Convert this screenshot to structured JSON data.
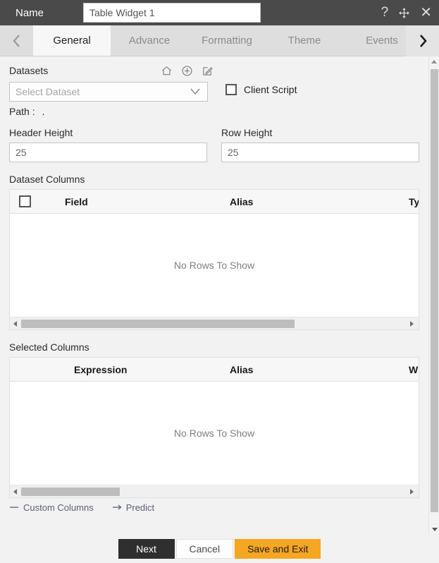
{
  "titlebar": {
    "name_label": "Name",
    "name_value": "Table Widget 1",
    "name_placeholder": "Name",
    "help_icon": "question-mark-icon",
    "move_icon": "move-arrows-icon",
    "close_icon": "close-icon"
  },
  "tabs": {
    "prev_icon": "chevron-left-icon",
    "next_icon": "chevron-right-icon",
    "items": [
      {
        "label": "General",
        "active": true
      },
      {
        "label": "Advance",
        "active": false
      },
      {
        "label": "Formatting",
        "active": false
      },
      {
        "label": "Theme",
        "active": false
      },
      {
        "label": "Events",
        "active": false
      }
    ]
  },
  "general": {
    "datasets_label": "Datasets",
    "dataset_icons": [
      {
        "name": "home-icon"
      },
      {
        "name": "add-circle-icon"
      },
      {
        "name": "edit-pencil-icon"
      }
    ],
    "dataset_select_placeholder": "Select Dataset",
    "dataset_select_value": "",
    "dropdown_icon": "chevron-down-icon",
    "client_script_label": "Client Script",
    "client_script_checked": false,
    "path_label": "Path :",
    "path_value": ".",
    "header_height_label": "Header Height",
    "header_height_value": "25",
    "row_height_label": "Row Height",
    "row_height_value": "25"
  },
  "dataset_columns": {
    "title": "Dataset Columns",
    "select_all_checked": false,
    "columns": [
      "Field",
      "Alias",
      "Ty"
    ],
    "rows": [],
    "empty_message": "No Rows To Show",
    "scroll_left_icon": "triangle-left-icon",
    "scroll_right_icon": "triangle-right-icon"
  },
  "selected_columns": {
    "title": "Selected Columns",
    "columns": [
      "Expression",
      "Alias",
      "W"
    ],
    "rows": [],
    "empty_message": "No Rows To Show",
    "scroll_left_icon": "triangle-left-icon",
    "scroll_right_icon": "triangle-right-icon"
  },
  "bottom_links": [
    {
      "label": "Custom Columns",
      "icon": "minus-icon"
    },
    {
      "label": "Predict",
      "icon": "arrow-right-icon"
    }
  ],
  "vscroll": {
    "up_icon": "triangle-up-icon",
    "down_icon": "triangle-down-icon"
  },
  "footer": {
    "next_label": "Next",
    "cancel_label": "Cancel",
    "save_label": "Save and Exit"
  },
  "colors": {
    "titlebar": "#4a4a4a",
    "tabbar": "#dedede",
    "accent": "#f5a623",
    "next_button": "#2f2f2f",
    "panel": "#f2f2f2"
  }
}
